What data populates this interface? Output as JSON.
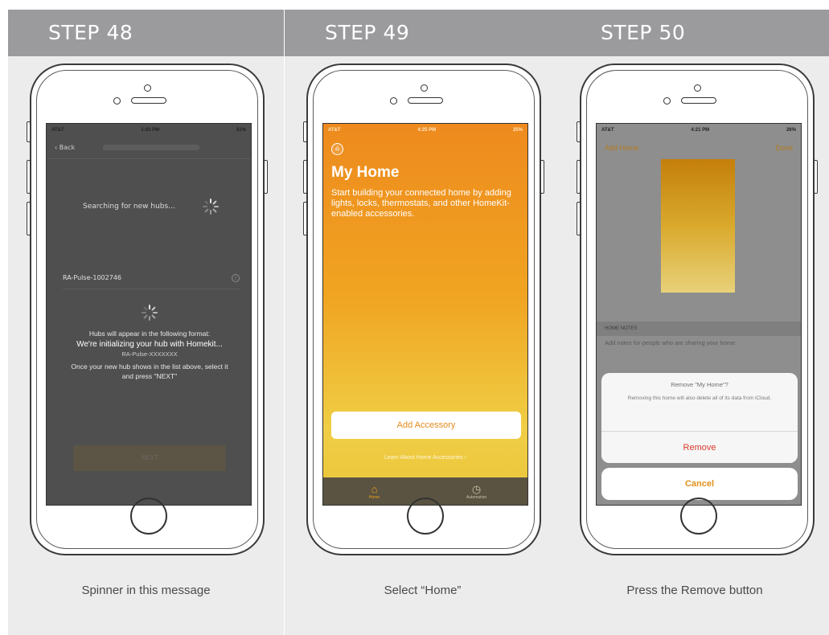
{
  "steps": [
    {
      "header": "STEP 48",
      "caption": "Spinner in this message",
      "screen": {
        "status_left": "AT&T",
        "status_time": "1:43 PM",
        "status_right": "51%",
        "back_label": "Back",
        "searching_text": "Searching for new hubs...",
        "hub_name": "RA-Pulse-1002746",
        "msg_format": "Hubs will appear in the following format:",
        "msg_initializing": "We're initializing your hub with Homekit...",
        "msg_example": "RA-Pulse-XXXXXXX",
        "msg_instructions_1": "Once your new hub shows in the list above, select it",
        "msg_instructions_2": "and press \"NEXT\"",
        "next_label": "NEXT"
      }
    },
    {
      "header": "STEP 49",
      "caption": "Select “Home”",
      "screen": {
        "status_left": "AT&T",
        "status_time": "4:25 PM",
        "status_right": "25%",
        "title": "My Home",
        "subtitle": "Start building your connected home by adding lights, locks, thermostats, and other HomeKit-enabled accessories.",
        "add_accessory_label": "Add Accessory",
        "learn_link": "Learn About Home Accessories ›",
        "tab_home": "Home",
        "tab_automation": "Automation"
      }
    },
    {
      "header": "STEP 50",
      "caption": "Press the Remove button",
      "screen": {
        "status_left": "AT&T",
        "status_time": "4:21 PM",
        "status_right": "26%",
        "nav_left": "Add Home",
        "nav_right": "Done",
        "section_header": "HOME NOTES",
        "notes_placeholder": "Add notes for people who are sharing your home.",
        "sheet_title": "Remove \"My Home\"?",
        "sheet_body": "Removing this home will also delete all of its data from iCloud.",
        "remove_label": "Remove",
        "cancel_label": "Cancel"
      }
    }
  ],
  "colors": {
    "header_bg": "#9b9b9d",
    "panel_bg": "#ececed",
    "home_orange": "#f0a421",
    "destructive_red": "#d83a2e"
  },
  "icons": [
    "home-icon",
    "spinner-icon",
    "info-icon",
    "automation-icon",
    "house-circle-icon"
  ]
}
